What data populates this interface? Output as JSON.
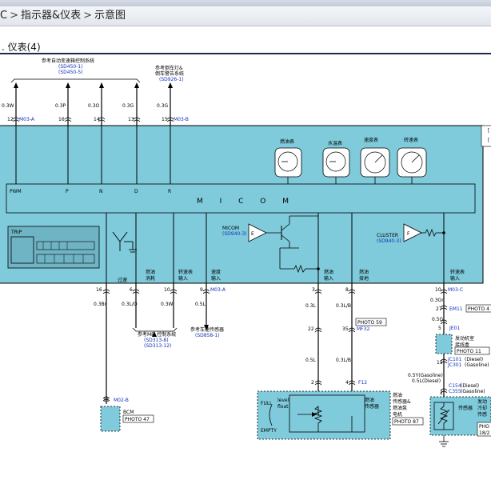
{
  "breadcrumb": {
    "part1": "C",
    "part2": "指示器&仪表",
    "part3": "示意图",
    "sep": ">"
  },
  "section_title": ". 仪表(4)",
  "diagram": {
    "refs": {
      "auto_trans_title": "参考自动变速箱控制系统",
      "auto_trans_code1": "(SD450-1)",
      "auto_trans_code2": "(SD450-5)",
      "backup_title1": "参考倒车灯&",
      "backup_title2": "倒车警告系统",
      "backup_code": "(SD926-1)",
      "mfi_title": "参考MFI 控制系统",
      "mfi_code1": "(SD313-8)",
      "mfi_code2": "(SD313-12)",
      "speed_sensor_title": "参考车速传感器",
      "speed_sensor_code": "(SD858-1)"
    },
    "top_pins": [
      {
        "wire": "0.3W",
        "pin": "12",
        "connector": "M03-A"
      },
      {
        "wire": "0.3P",
        "pin": "16",
        "connector": ""
      },
      {
        "wire": "0.3O",
        "pin": "14",
        "connector": ""
      },
      {
        "wire": "0.3G",
        "pin": "13",
        "connector": ""
      },
      {
        "wire": "0.3G",
        "pin": "15",
        "connector": "M03-B"
      }
    ],
    "inputs": [
      "PWM",
      "P",
      "N",
      "D",
      "R"
    ],
    "micom_label": "M I C O M",
    "gauges": [
      "燃油表",
      "水温表",
      "速度表",
      "转速表"
    ],
    "lcd_label": "TRIP",
    "micom_block": {
      "label": "MICOM",
      "code": "(SD940-3)",
      "glyph": "E"
    },
    "cluster_block": {
      "label": "CLUSTER",
      "code": "(SD940-3)",
      "glyph": "F"
    },
    "output_labels": {
      "guo_su": "过速",
      "fuel_cons1": "燃油",
      "fuel_cons2": "消耗",
      "tach_in1": "转速表",
      "tach_in2": "输入",
      "speed_in1": "速度",
      "speed_in2": "输入",
      "fuel_in1": "燃油",
      "fuel_in2": "输入",
      "fuel_gnd1": "燃油",
      "fuel_gnd2": "接地",
      "tach_in_right1": "转速表",
      "tach_in_right2": "输入"
    },
    "bottom_pins": [
      {
        "pin": "16",
        "wire": "0.3Br",
        "connector": ""
      },
      {
        "pin": "6",
        "wire": "0.3L/O",
        "connector": ""
      },
      {
        "pin": "10",
        "wire": "0.3W",
        "connector": ""
      },
      {
        "pin": "9",
        "wire": "0.5L",
        "connector": "M03-A"
      },
      {
        "pin": "3",
        "wire": "0.3L",
        "connector": ""
      },
      {
        "pin": "8",
        "wire": "0.3L/B",
        "connector": ""
      },
      {
        "pin": "10",
        "wire": "0.3Gr",
        "connector": "M03-C"
      }
    ],
    "fuel_lines": {
      "pin22": "22",
      "pin35": "35",
      "mf32": "MF32",
      "photo59": "PHOTO 59",
      "wire_lower_left": "0.5L",
      "wire_lower_right": "0.3L/B",
      "pin2": "2",
      "pin4": "4",
      "f12": "F12"
    },
    "bcm": {
      "pin": "11",
      "connector": "M02-B",
      "label": "BCM",
      "photo": "PHOTO 47"
    },
    "fuel_sender": {
      "full1": "FULL",
      "full2": "level",
      "full3": "float",
      "empty": "EMPTY",
      "sensor_label1": "燃油",
      "sensor_label2": "传感器",
      "pump_label1": "燃油",
      "pump_label2": "传感器&",
      "pump_label3": "燃油泵",
      "pump_label4": "电机",
      "photo": "PHOTO 87"
    },
    "right_chain": {
      "pin27": "27",
      "em11": "EM11",
      "photo_right": "PHOTO 4",
      "wire_mid": "0.5G",
      "pin5": "5",
      "je01": "JE01",
      "junction_label1": "发动机室",
      "junction_label2": "接线盒",
      "photo11": "PHOTO 11",
      "jc101": "JC101",
      "jc101_note": "(Diesel)",
      "jc301": "JC301",
      "jc301_note": "(Gasoline)",
      "pin15": "15",
      "wire_diesel": "0.5Y(Gasoline)",
      "wire_gasoline": "0.5L(Diesel)",
      "c154": "C154",
      "c154_note": "(Diesel)",
      "c355": "C355",
      "c355_note": "(Gasoline)",
      "pin2": "2",
      "sensor_label": "传感器",
      "temp_label1": "发动",
      "temp_label2": "冷却",
      "temp_label3": "传感",
      "photo_tail1": "PHO",
      "photo_tail2": "18/2"
    },
    "legend_marks": [
      "[",
      "["
    ]
  }
}
